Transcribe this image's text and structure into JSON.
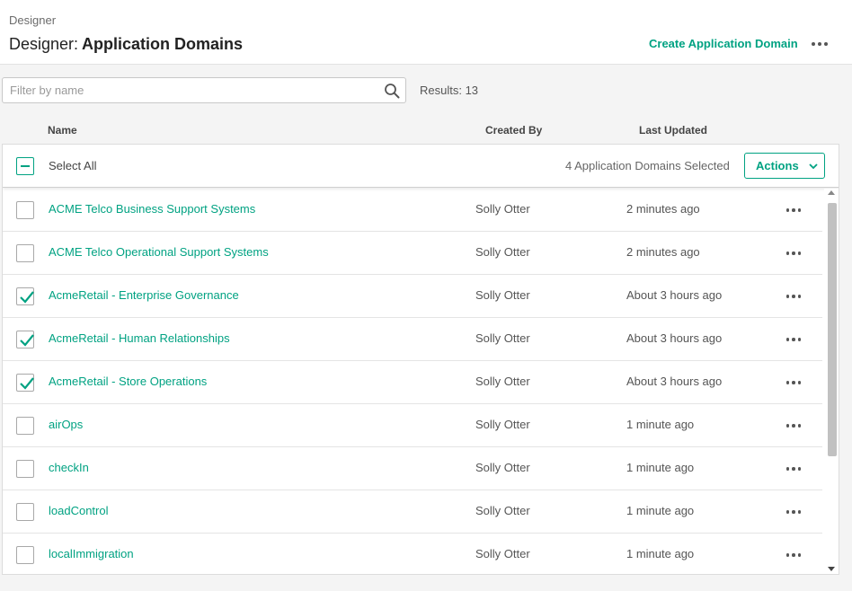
{
  "header": {
    "breadcrumb": "Designer",
    "title_prefix": "Designer:",
    "title": "Application Domains",
    "create_label": "Create Application Domain"
  },
  "filter": {
    "placeholder": "Filter by name",
    "value": "",
    "results_label": "Results: 13"
  },
  "columns": {
    "name": "Name",
    "created_by": "Created By",
    "last_updated": "Last Updated"
  },
  "selection": {
    "select_all_label": "Select All",
    "selected_count_label": "4 Application Domains Selected",
    "actions_label": "Actions"
  },
  "rows": [
    {
      "name": "ACME Telco Business Support Systems",
      "created_by": "Solly Otter",
      "updated": "2 minutes ago",
      "checked": false
    },
    {
      "name": "ACME Telco Operational Support Systems",
      "created_by": "Solly Otter",
      "updated": "2 minutes ago",
      "checked": false
    },
    {
      "name": "AcmeRetail - Enterprise Governance",
      "created_by": "Solly Otter",
      "updated": "About 3 hours ago",
      "checked": true
    },
    {
      "name": "AcmeRetail - Human Relationships",
      "created_by": "Solly Otter",
      "updated": "About 3 hours ago",
      "checked": true
    },
    {
      "name": "AcmeRetail - Store Operations",
      "created_by": "Solly Otter",
      "updated": "About 3 hours ago",
      "checked": true
    },
    {
      "name": "airOps",
      "created_by": "Solly Otter",
      "updated": "1 minute ago",
      "checked": false
    },
    {
      "name": "checkIn",
      "created_by": "Solly Otter",
      "updated": "1 minute ago",
      "checked": false
    },
    {
      "name": "loadControl",
      "created_by": "Solly Otter",
      "updated": "1 minute ago",
      "checked": false
    },
    {
      "name": "localImmigration",
      "created_by": "Solly Otter",
      "updated": "1 minute ago",
      "checked": false
    }
  ],
  "colors": {
    "accent": "#00a282",
    "text": "#333333",
    "muted": "#666666",
    "border": "#dcdcdc",
    "background": "#f4f4f4"
  },
  "icons": {
    "search": "search-icon",
    "more": "more-icon",
    "check": "check-icon",
    "chevron": "chevron-down-icon"
  }
}
